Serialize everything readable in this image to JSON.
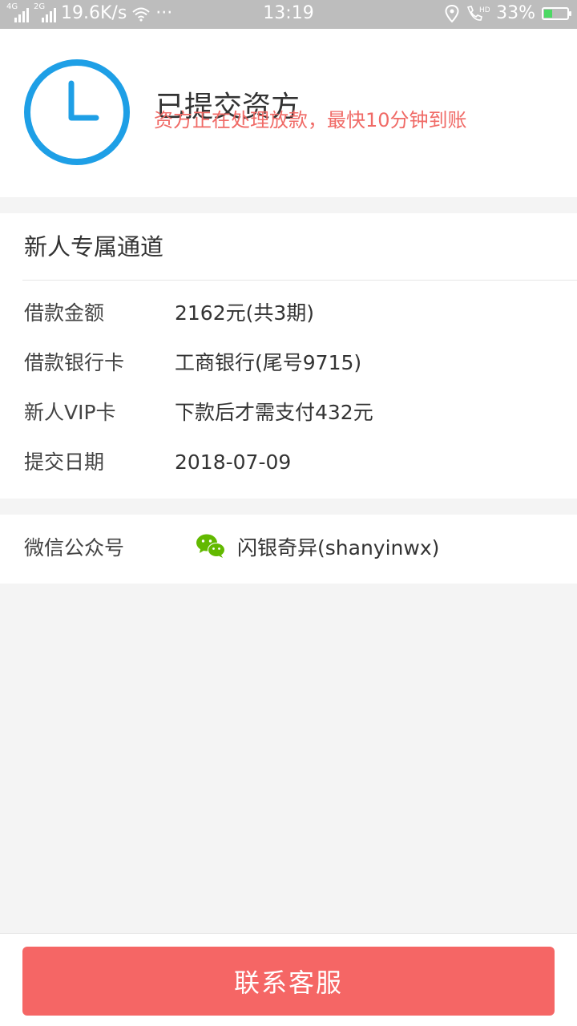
{
  "status_bar": {
    "net_4g": "4G",
    "net_2g": "2G",
    "speed": "19.6K/s",
    "dots": "···",
    "time": "13:19",
    "battery": "33%",
    "battery_level": 0.33
  },
  "header": {
    "title": "已提交资方",
    "subtitle": "资方正在处理放款，最快10分钟到账"
  },
  "details": {
    "title": "新人专属通道",
    "rows": [
      {
        "label": "借款金额",
        "value": "2162元(共3期)"
      },
      {
        "label": "借款银行卡",
        "value": "工商银行(尾号9715)"
      },
      {
        "label": "新人VIP卡",
        "value": "下款后才需支付432元"
      },
      {
        "label": "提交日期",
        "value": "2018-07-09"
      }
    ]
  },
  "wechat": {
    "label": "微信公众号",
    "value": "闪银奇异(shanyinwx)"
  },
  "footer": {
    "contact_label": "联系客服"
  },
  "colors": {
    "accent_blue": "#1e9fe6",
    "subtitle_red": "#f06a66",
    "button_red": "#f56665",
    "wechat_green": "#62b900"
  }
}
